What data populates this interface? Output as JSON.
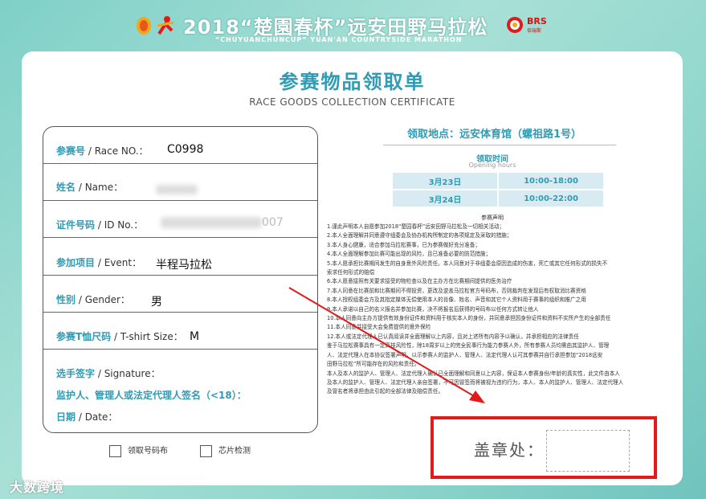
{
  "banner": {
    "title": "2018“楚園春杯”远安田野马拉松",
    "subtitle": "“CHUYUANCHUNCUP” YUAN'AN COUNTRYSIDE MARATHON",
    "brand": "BRS",
    "brand_sub": "佰瑞斯"
  },
  "card": {
    "title_cn": "参赛物品领取单",
    "title_en": "RACE GOODS COLLECTION CERTIFICATE"
  },
  "form": {
    "race_no": {
      "label_cn": "参赛号",
      "label_en": " / Race NO.：",
      "value": "C0998"
    },
    "name": {
      "label_cn": "姓名",
      "label_en": " / Name："
    },
    "id_no": {
      "label_cn": "证件号码",
      "label_en": " / ID No.：",
      "value_tail": "007"
    },
    "event": {
      "label_cn": "参加项目",
      "label_en": " / Event：",
      "value": "半程马拉松"
    },
    "gender": {
      "label_cn": "性别",
      "label_en": " / Gender：",
      "value": "男"
    },
    "tshirt": {
      "label_cn": "参赛T恤尺码",
      "label_en": " / T-shirt Size：",
      "value": "M"
    },
    "signature": {
      "label_cn": "选手签字",
      "label_en": " / Signature：",
      "guardian": "监护人、管理人或法定代理人签名（<18）：",
      "date_cn": "日期",
      "date_en": " / Date："
    }
  },
  "checks": {
    "bib": "领取号码布",
    "chip": "芯片检测"
  },
  "info": {
    "location": "领取地点：远安体育馆（螺祖路1号）",
    "hours_cn": "领取时间",
    "hours_en": "Opening hours",
    "schedule": [
      {
        "date": "3月23日",
        "time": "10:00-18:00"
      },
      {
        "date": "3月24日",
        "time": "10:00-22:00"
      }
    ],
    "declaration_title": "参赛声明",
    "declaration": [
      "1.谨此声明本人自愿参加2018“楚园春杯”远安田野马拉松及一切相关活动；",
      "2.本人全面理解并同意遵守组委会及协办机构所制定的各项规定及采取的措施；",
      "3.本人身心健康，适合参加马拉松赛事，已为参赛做好充分准备；",
      "4.本人全面理解参加比赛可能出现的风险，且已准备必要的防范措施；",
      "5.本人愿承担比赛期间发生的自身意外风险责任。本人同意对于非组委会原因造成的伤害，死亡或其它任何形式的损失不",
      "索求任何形式的赔偿",
      "6.本人愿意接照有关要求接受的物检查以及在主办方在比赛期间提供的医务治疗",
      "7.本人同意在比赛前和比赛期间不得投资，更改及逆盖马拉松官方号码布，否则裁判在发现后有权取消比赛资格",
      "8.本人授权组委会方及其指定媒体无偿使用本人的肖像、姓名、声音和其它个人资料用于赛事的组织和推广之用",
      "9.本人承诺以自己的名义报名并参加比赛，决不将报名后获得的号码布以任何方式转让他人",
      "10.本人同意向主办方提供有效身份证件和资料用于核实本人的身份，并同意承担因身份证件和资料不实所产生的全部责任",
      "11.本人同意并接受大会免费提供的意外保险",
      "12.本人或法定代理人已认真阅读并全面理解以上内容，且对上述所有内容予以确认，并承担相应的法律责任",
      "鉴于马拉松赛事具有一定高技风险性，除18周岁以上的完全民事行为能力参赛人外，所有参赛人员均需由其监护人、管理",
      "人、法定代理人在本协议签署声明，以示参赛人的监护人、管理人、法定代理人认可其参赛并自行承担参加“2018远安",
      "田野马拉松”所可能存在的风险和责任。",
      "本人及本人的监护人、管理人、法定代理人确认已全面理解和同意以上内容，保证本人参赛身份/年龄的真实性，此文件由本人",
      "及本人的监护人、管理人、法定代理人亲自签署，不可因冒签而将被视为违约行为，本人、本人的监护人、管理人、法定代理人",
      "及冒名者将承担由此引起的全部法律及赔偿责任。"
    ]
  },
  "stamp": {
    "label": "盖章处："
  },
  "watermark": "大数跨境",
  "colors": {
    "accent": "#2f9bb4",
    "highlight": "#e21a1a",
    "background": "#8fd6cc"
  }
}
